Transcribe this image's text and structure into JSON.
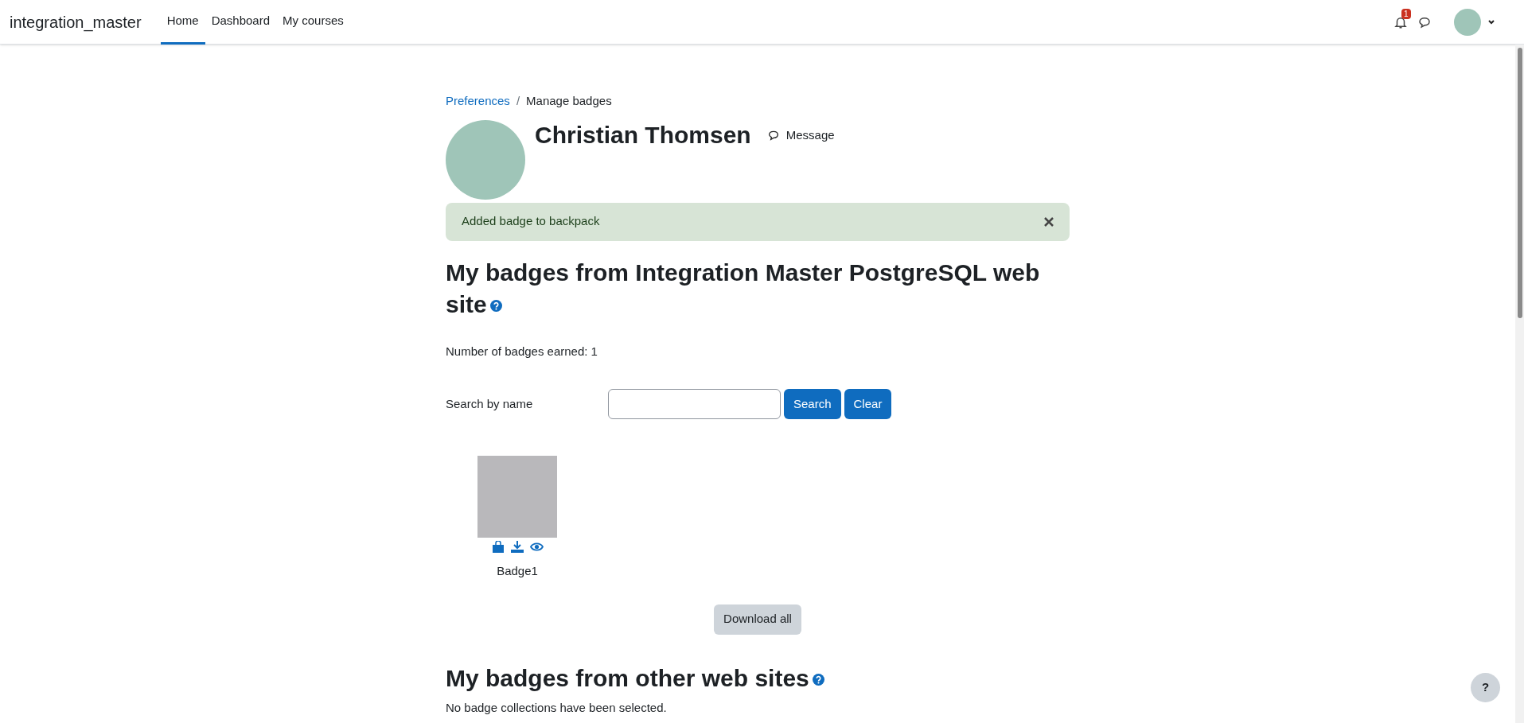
{
  "navbar": {
    "brand": "integration_master",
    "items": [
      {
        "label": "Home",
        "selected": true
      },
      {
        "label": "Dashboard",
        "selected": false
      },
      {
        "label": "My courses",
        "selected": false
      }
    ],
    "notification_count": "1"
  },
  "breadcrumb_separator": "/",
  "breadcrumb": [
    {
      "label": "Preferences",
      "kind": "link"
    },
    {
      "label": "Manage badges",
      "kind": "current"
    }
  ],
  "profile": {
    "name": "Christian Thomsen",
    "message_button": "Message"
  },
  "alert": {
    "text": "Added badge to backpack"
  },
  "section_site": {
    "heading": "My badges from Integration Master PostgreSQL web site",
    "count_text": "Number of badges earned: 1",
    "search_label": "Search by name",
    "search_button": "Search",
    "clear_button": "Clear",
    "badges": [
      {
        "name": "Badge1"
      }
    ],
    "download_button": "Download all"
  },
  "section_other": {
    "heading": "My badges from other web sites",
    "note": "No badge collections have been selected."
  },
  "help_button": "?"
}
